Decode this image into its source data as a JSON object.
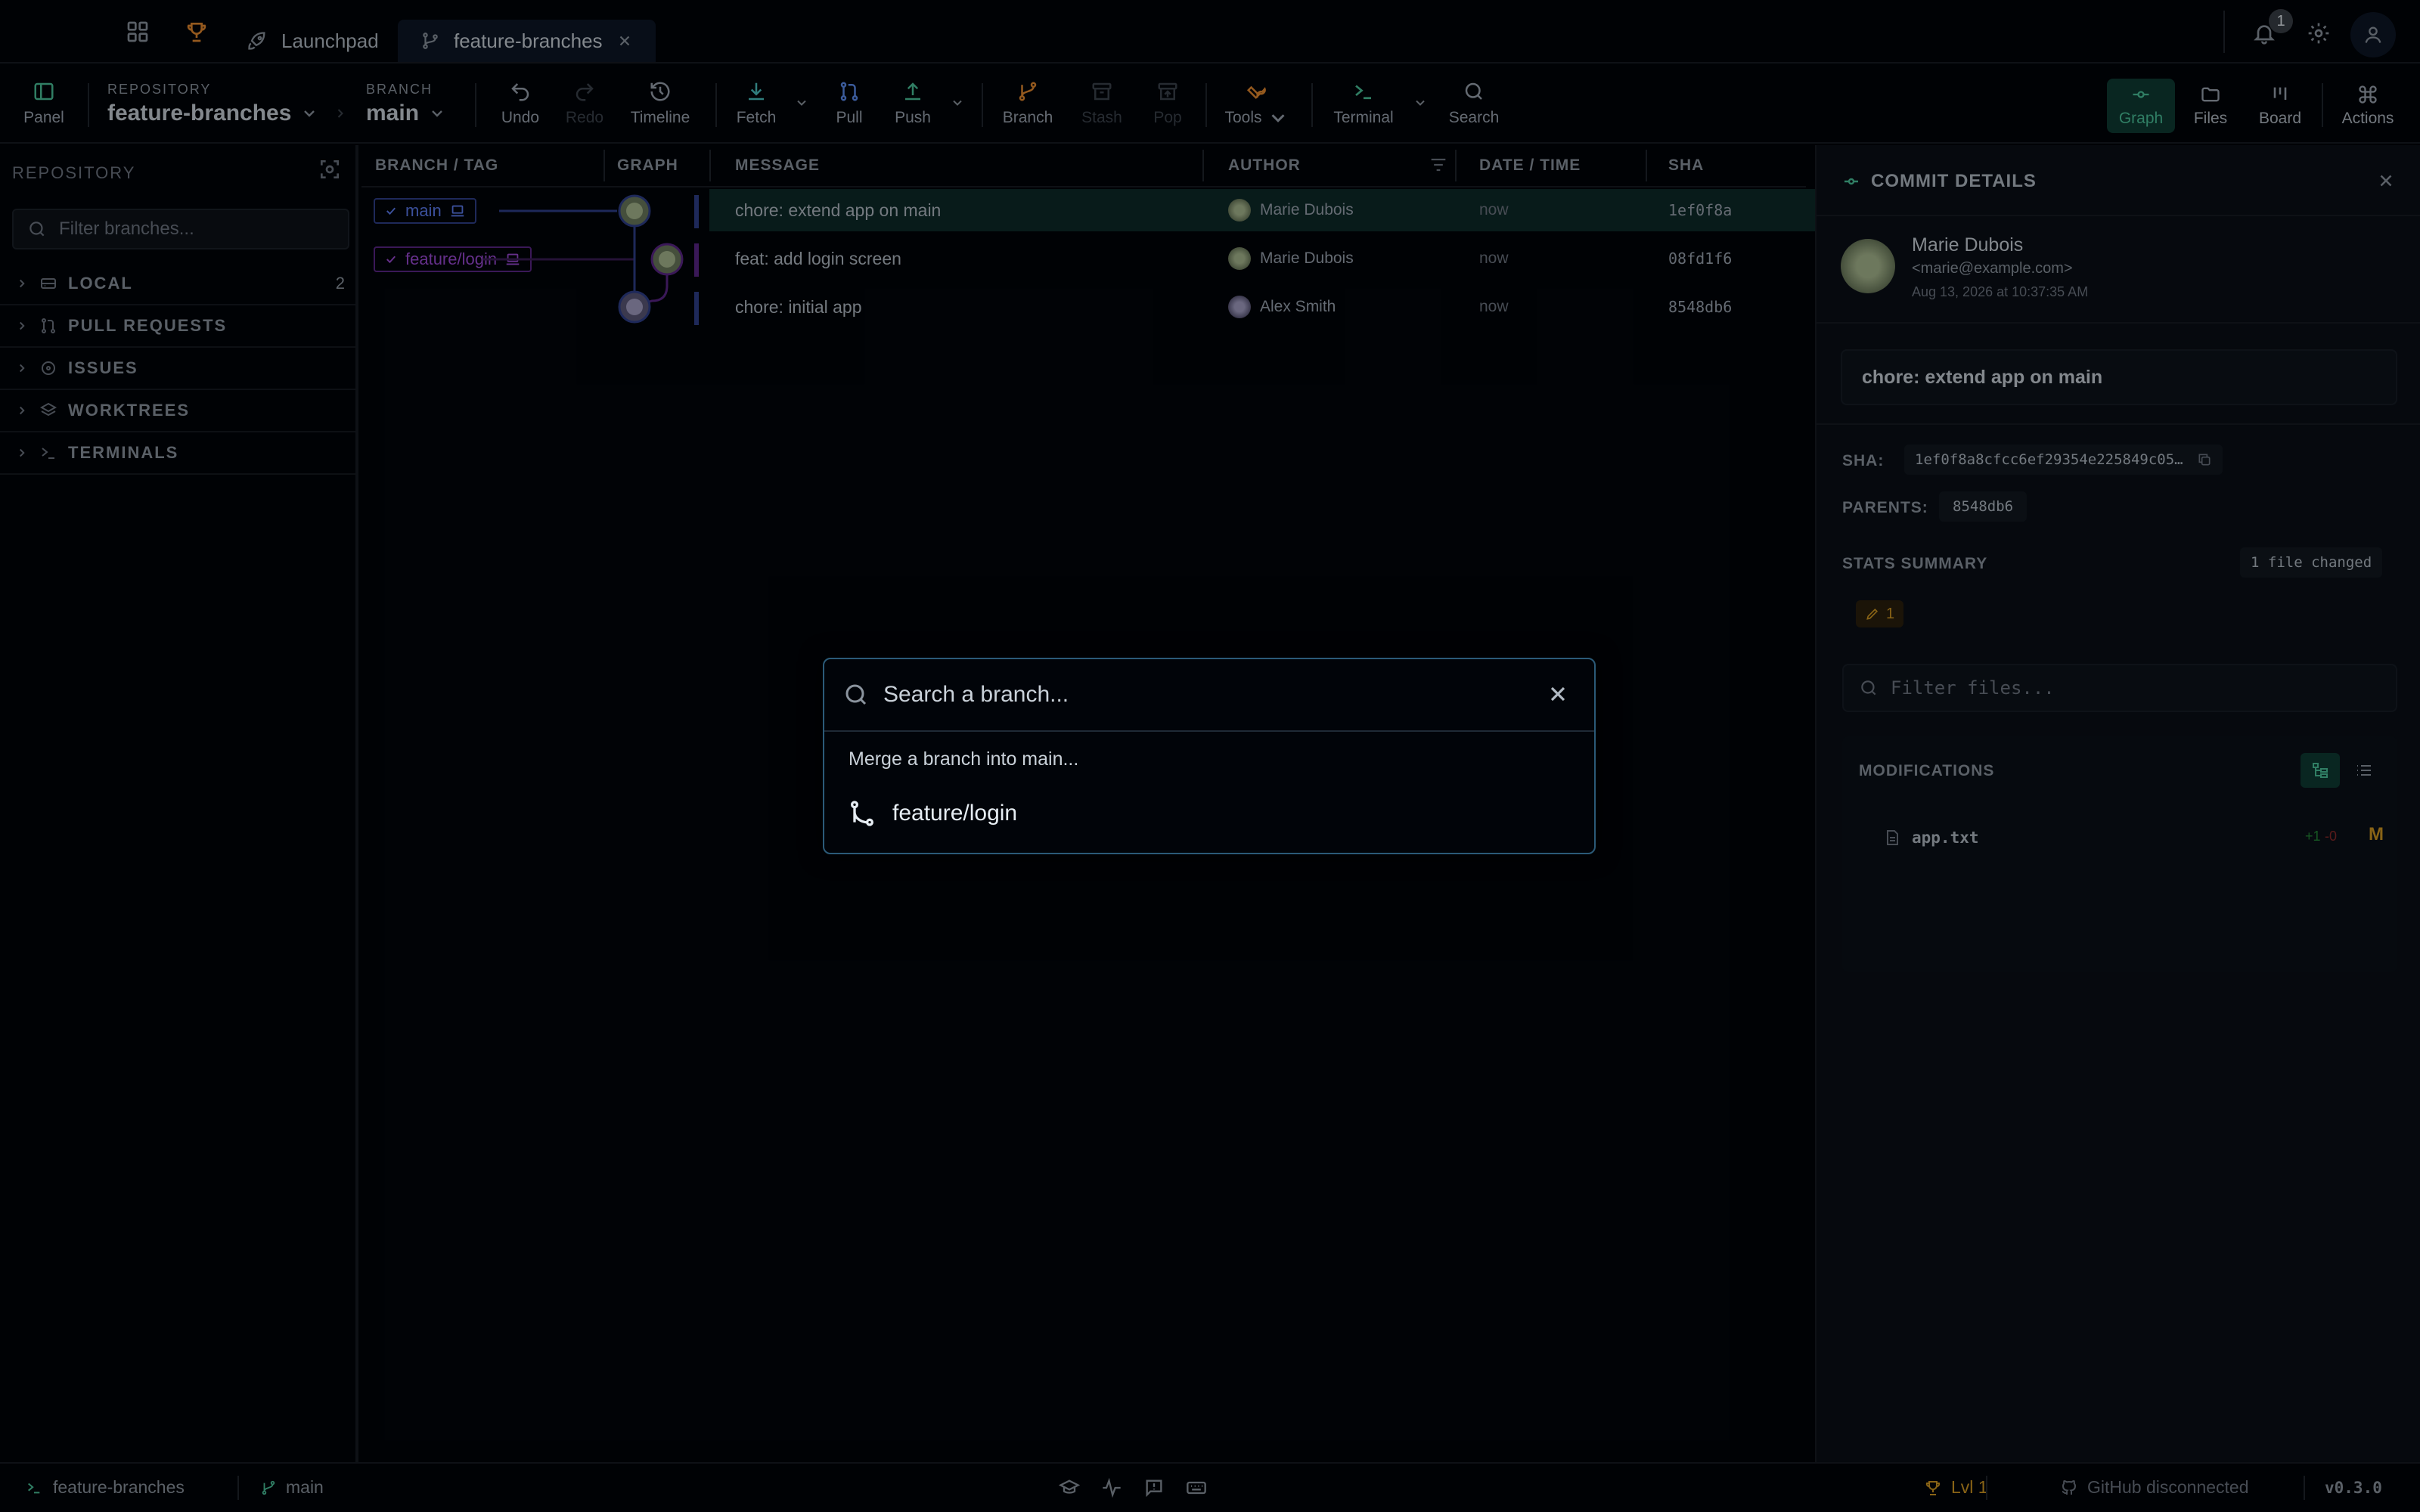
{
  "tabs": {
    "launchpad": "Launchpad",
    "repo_tab": "feature-branches",
    "notification_count": "1"
  },
  "toolbar": {
    "panel": "Panel",
    "repository_label": "REPOSITORY",
    "repository_value": "feature-branches",
    "branch_label": "BRANCH",
    "branch_value": "main",
    "undo": "Undo",
    "redo": "Redo",
    "timeline": "Timeline",
    "fetch": "Fetch",
    "pull": "Pull",
    "push": "Push",
    "branch": "Branch",
    "stash": "Stash",
    "pop": "Pop",
    "tools": "Tools",
    "terminal": "Terminal",
    "search": "Search",
    "graph": "Graph",
    "files": "Files",
    "board": "Board",
    "actions": "Actions"
  },
  "sidebar": {
    "title": "REPOSITORY",
    "filter_placeholder": "Filter branches...",
    "sections": [
      {
        "label": "LOCAL",
        "count": "2",
        "icon": "drive-icon"
      },
      {
        "label": "PULL REQUESTS",
        "count": "",
        "icon": "pull-request-icon"
      },
      {
        "label": "ISSUES",
        "count": "",
        "icon": "issue-icon"
      },
      {
        "label": "WORKTREES",
        "count": "",
        "icon": "layers-icon"
      },
      {
        "label": "TERMINALS",
        "count": "",
        "icon": "terminal-icon"
      }
    ]
  },
  "graph": {
    "columns": {
      "branch_tag": "BRANCH / TAG",
      "graph": "GRAPH",
      "message": "MESSAGE",
      "author": "AUTHOR",
      "date_time": "DATE / TIME",
      "sha": "SHA"
    },
    "rows": [
      {
        "ref": "main",
        "message": "chore: extend app on main",
        "author": "Marie Dubois",
        "date": "now",
        "sha": "1ef0f8a"
      },
      {
        "ref": "feature/login",
        "message": "feat: add login screen",
        "author": "Marie Dubois",
        "date": "now",
        "sha": "08fd1f6"
      },
      {
        "ref": "",
        "message": "chore: initial app",
        "author": "Alex Smith",
        "date": "now",
        "sha": "8548db6"
      }
    ],
    "colors": {
      "main": "#3b5bdb",
      "feature": "#7b2fbe",
      "selected_row": "#0d2a28"
    }
  },
  "details": {
    "title": "COMMIT DETAILS",
    "author_name": "Marie Dubois",
    "author_email": "<marie@example.com>",
    "author_date": "Aug 13, 2026 at 10:37:35 AM",
    "message": "chore: extend app on main",
    "sha_label": "SHA:",
    "sha_value": "1ef0f8a8cfcc6ef29354e225849c05…",
    "parents_label": "PARENTS:",
    "parents_value": "8548db6",
    "stats_label": "STATS SUMMARY",
    "stats_changed": "1 file changed",
    "stats_modified_count": "1",
    "filter_placeholder": "Filter files...",
    "modifications_label": "MODIFICATIONS",
    "files": [
      {
        "name": "app.txt",
        "added": "+1",
        "removed": "-0",
        "status": "M"
      }
    ]
  },
  "modal": {
    "search_placeholder": "Search a branch...",
    "heading": "Merge a branch into main...",
    "options": [
      "feature/login"
    ]
  },
  "statusbar": {
    "repo": "feature-branches",
    "branch": "main",
    "level": "Lvl 1",
    "github": "GitHub disconnected",
    "version": "v0.3.0"
  }
}
